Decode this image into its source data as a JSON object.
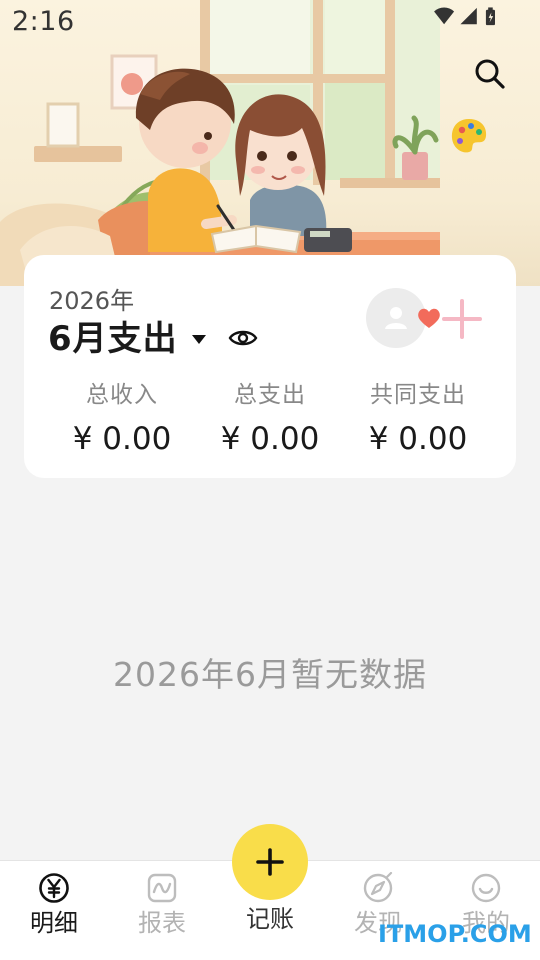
{
  "status_bar": {
    "time": "2:16",
    "icons": [
      "wifi-icon",
      "cell-signal-icon",
      "battery-icon"
    ]
  },
  "header": {
    "search_icon": "search-icon",
    "theme_icon": "palette-icon"
  },
  "summary": {
    "year": "2026年",
    "month_title": "6月支出",
    "stats": [
      {
        "label": "总收入",
        "value": "¥ 0.00"
      },
      {
        "label": "总支出",
        "value": "¥ 0.00"
      },
      {
        "label": "共同支出",
        "value": "¥ 0.00"
      }
    ]
  },
  "empty_state": {
    "message": "2026年6月暂无数据"
  },
  "bottom_nav": {
    "items": [
      {
        "label": "明细",
        "icon": "yen-circle-icon",
        "active": true
      },
      {
        "label": "报表",
        "icon": "chart-icon",
        "active": false
      },
      {
        "label": "记账",
        "icon": "plus-icon",
        "active": false
      },
      {
        "label": "发现",
        "icon": "compass-icon",
        "active": false
      },
      {
        "label": "我的",
        "icon": "smile-icon",
        "active": false
      }
    ]
  },
  "watermark": "ITMOP.COM",
  "colors": {
    "accent": "#f9dd4a",
    "heart": "#f26b5b",
    "add_partner": "#f5b8c4",
    "watermark": "#2aa0e8"
  }
}
